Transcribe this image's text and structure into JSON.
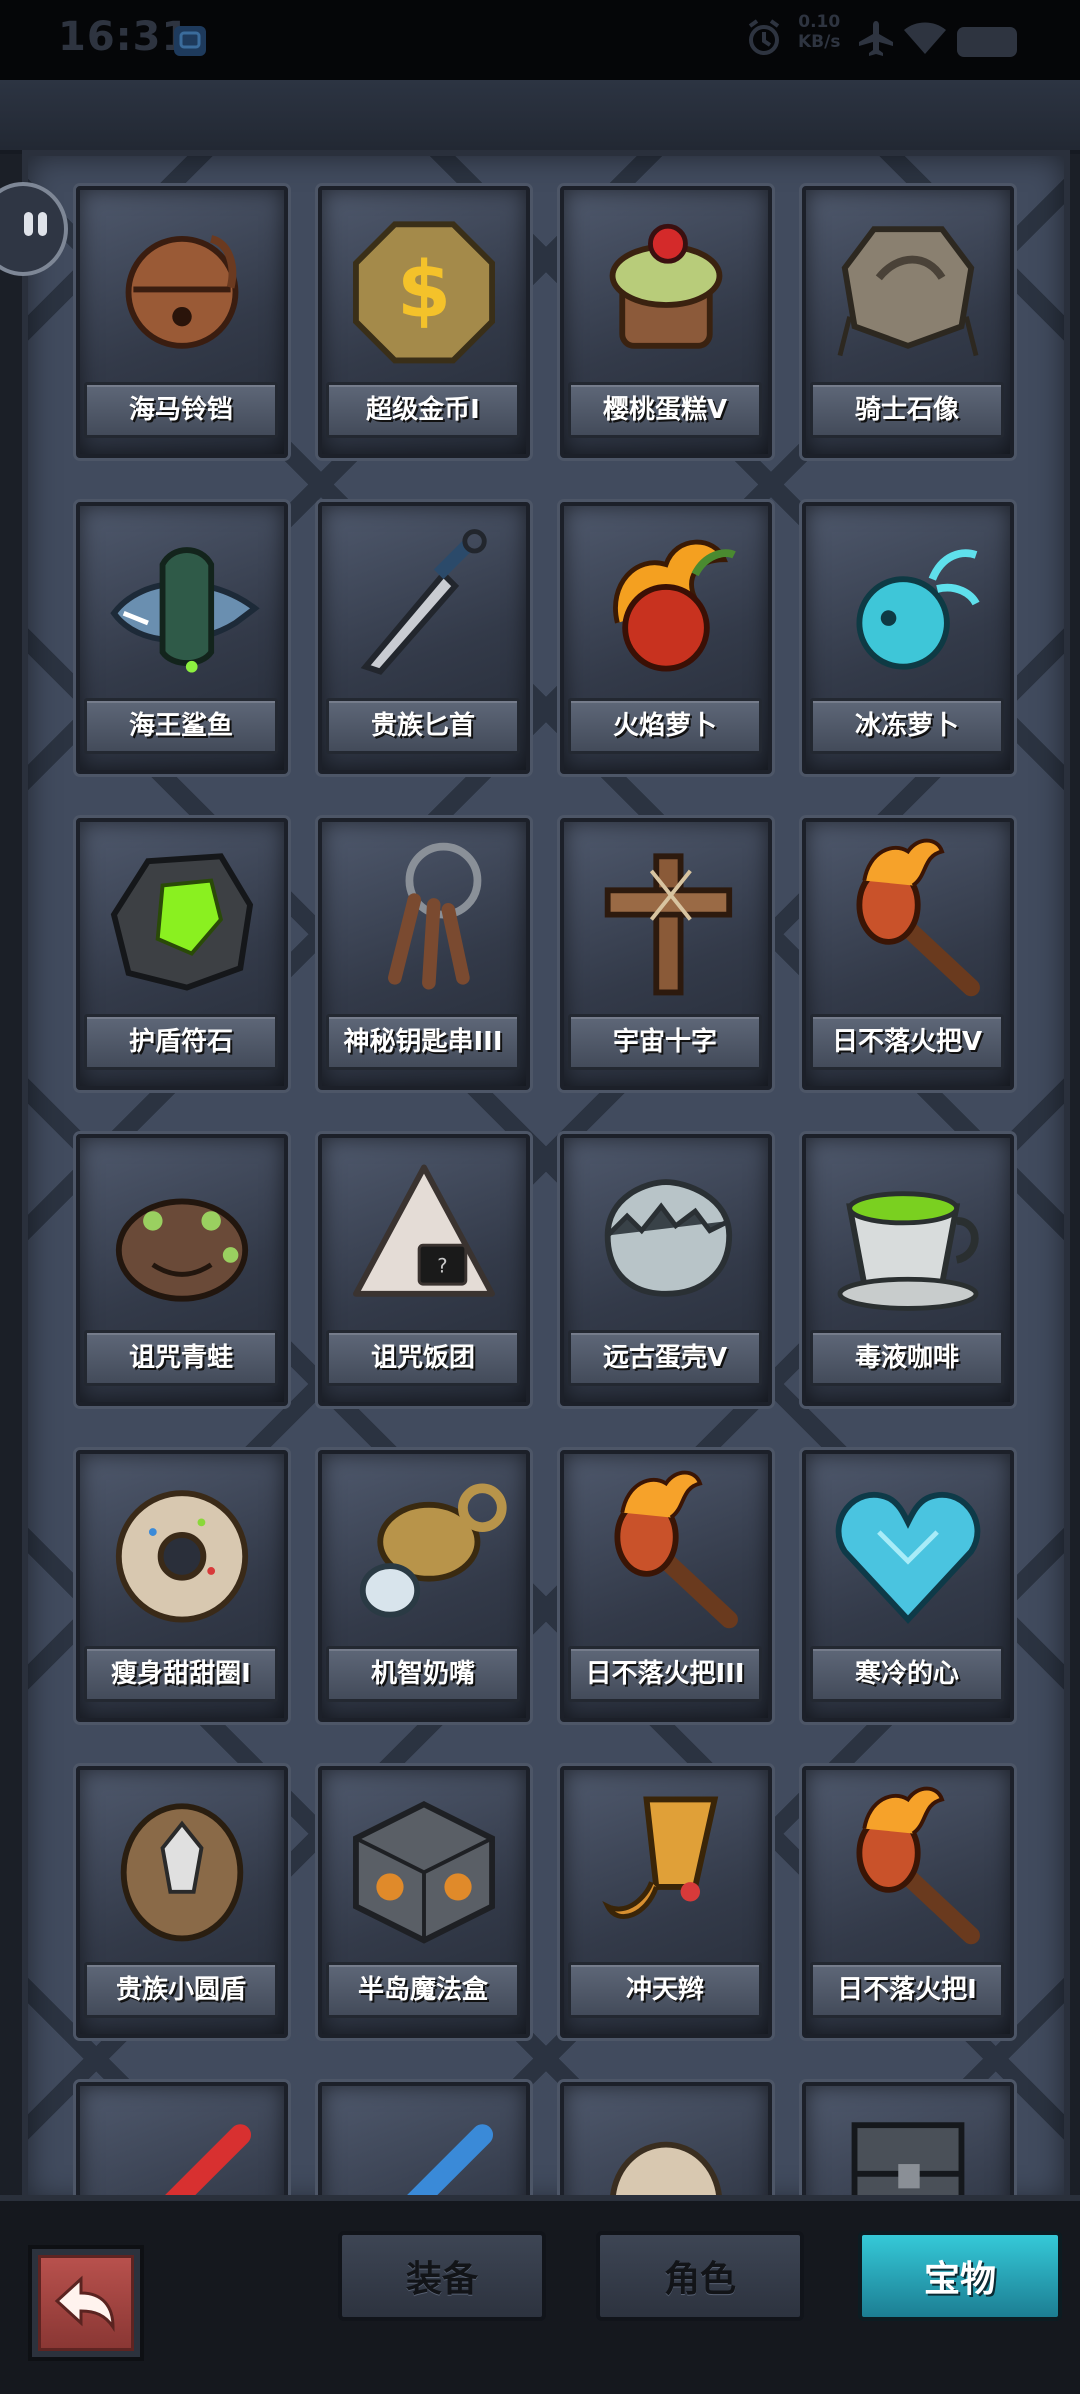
{
  "status_bar": {
    "time": "16:31",
    "network_speed_value": "0.10",
    "network_speed_unit": "KB/s",
    "icons": [
      "app-icon",
      "alarm-icon",
      "airplane-icon",
      "wifi-icon",
      "battery-icon"
    ]
  },
  "side_button": {
    "icon": "pause-icon"
  },
  "items": [
    {
      "label": "海马铃铛",
      "icon": "bell-icon"
    },
    {
      "label": "超级金币I",
      "icon": "gold-coin-icon"
    },
    {
      "label": "樱桃蛋糕V",
      "icon": "cherry-cake-icon"
    },
    {
      "label": "骑士石像",
      "icon": "stone-statue-icon"
    },
    {
      "label": "海王鲨鱼",
      "icon": "shark-icon"
    },
    {
      "label": "贵族匕首",
      "icon": "dagger-icon"
    },
    {
      "label": "火焰萝卜",
      "icon": "fire-radish-icon"
    },
    {
      "label": "冰冻萝卜",
      "icon": "ice-radish-icon"
    },
    {
      "label": "护盾符石",
      "icon": "shield-rune-icon"
    },
    {
      "label": "神秘钥匙串III",
      "icon": "key-ring-icon"
    },
    {
      "label": "宇宙十字",
      "icon": "wooden-cross-icon"
    },
    {
      "label": "日不落火把V",
      "icon": "torch-icon"
    },
    {
      "label": "诅咒青蛙",
      "icon": "cursed-frog-icon"
    },
    {
      "label": "诅咒饭团",
      "icon": "rice-ball-icon"
    },
    {
      "label": "远古蛋壳V",
      "icon": "eggshell-icon"
    },
    {
      "label": "毒液咖啡",
      "icon": "poison-coffee-icon"
    },
    {
      "label": "瘦身甜甜圈I",
      "icon": "donut-icon"
    },
    {
      "label": "机智奶嘴",
      "icon": "pacifier-icon"
    },
    {
      "label": "日不落火把III",
      "icon": "torch-icon"
    },
    {
      "label": "寒冷的心",
      "icon": "ice-heart-icon"
    },
    {
      "label": "贵族小圆盾",
      "icon": "round-shield-icon"
    },
    {
      "label": "半岛魔法盒",
      "icon": "magic-box-icon"
    },
    {
      "label": "冲天辫",
      "icon": "pigtail-icon"
    },
    {
      "label": "日不落火把I",
      "icon": "torch-icon"
    },
    {
      "label": "",
      "icon": "red-sword-icon"
    },
    {
      "label": "",
      "icon": "blue-sword-icon"
    },
    {
      "label": "",
      "icon": "stone-face-icon"
    },
    {
      "label": "",
      "icon": "iron-chest-icon"
    }
  ],
  "bottom_nav": {
    "back_icon": "return-arrow-icon",
    "tabs": [
      {
        "label": "装备",
        "active": false
      },
      {
        "label": "角色",
        "active": false
      },
      {
        "label": "宝物",
        "active": true
      }
    ]
  },
  "colors": {
    "accent_active_tab": "#27a8bb",
    "back_button": "#a9433f",
    "board": "#414b5e"
  }
}
